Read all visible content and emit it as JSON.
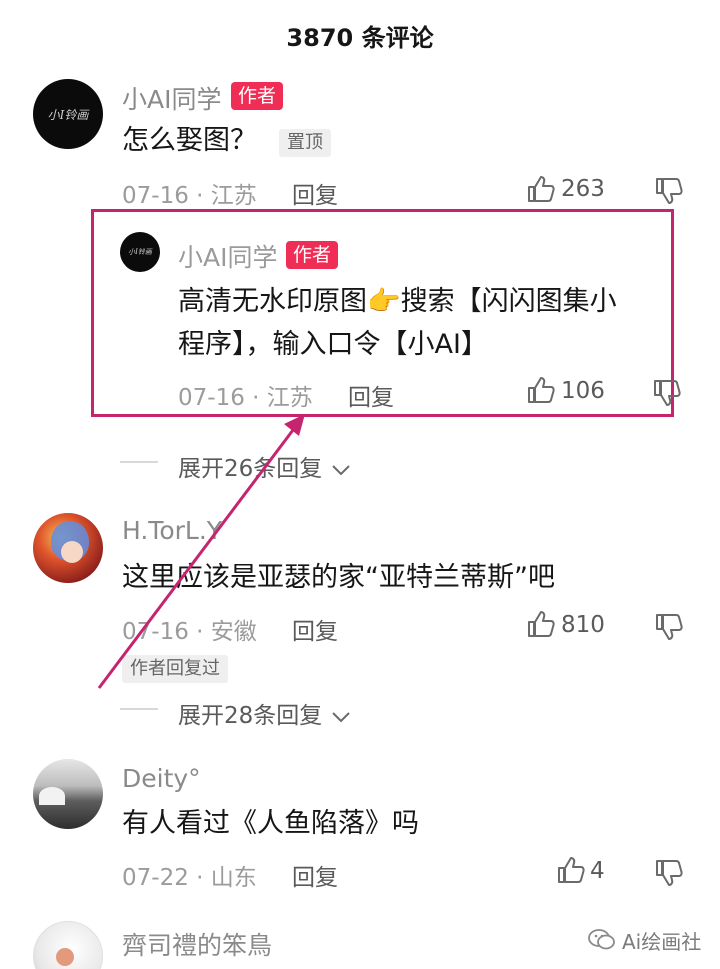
{
  "header": {
    "title": "3870 条评论"
  },
  "comments": [
    {
      "username": "小AI同学",
      "author_badge": "作者",
      "content": "怎么娶图？",
      "pin_badge": "置顶",
      "date_location": "07-16 · 江苏",
      "reply_label": "回复",
      "likes": "263",
      "avatar_text": "小I铃画"
    },
    {
      "username": "小AI同学",
      "author_badge": "作者",
      "content_line1": "高清无水印原图👉搜索【闪闪图集小",
      "content_line2": "程序】，输入口令【小AI】",
      "date_location": "07-16 · 江苏",
      "reply_label": "回复",
      "likes": "106",
      "avatar_text": "小I铃画"
    },
    {
      "username": "H.TorL.Y",
      "content": "这里应该是亚瑟的家“亚特兰蒂斯”吧",
      "date_location": "07-16 · 安徽",
      "reply_label": "回复",
      "likes": "810",
      "author_replied_badge": "作者回复过"
    },
    {
      "username": "Deity°",
      "content": "有人看过《人鱼陷落》吗",
      "date_location": "07-22 · 山东",
      "reply_label": "回复",
      "likes": "4"
    },
    {
      "username": "齊司禮的笨鳥"
    }
  ],
  "expand_1": "展开26条回复",
  "expand_2": "展开28条回复",
  "watermark": {
    "text": "Ai绘画社"
  },
  "colors": {
    "author_badge": "#f02d55",
    "highlight": "#c5246f",
    "text": "#161616",
    "meta": "#9b9b9b"
  },
  "icons": [
    "thumb-up-icon",
    "thumb-down-icon",
    "chevron-down-icon",
    "wechat-icon"
  ]
}
